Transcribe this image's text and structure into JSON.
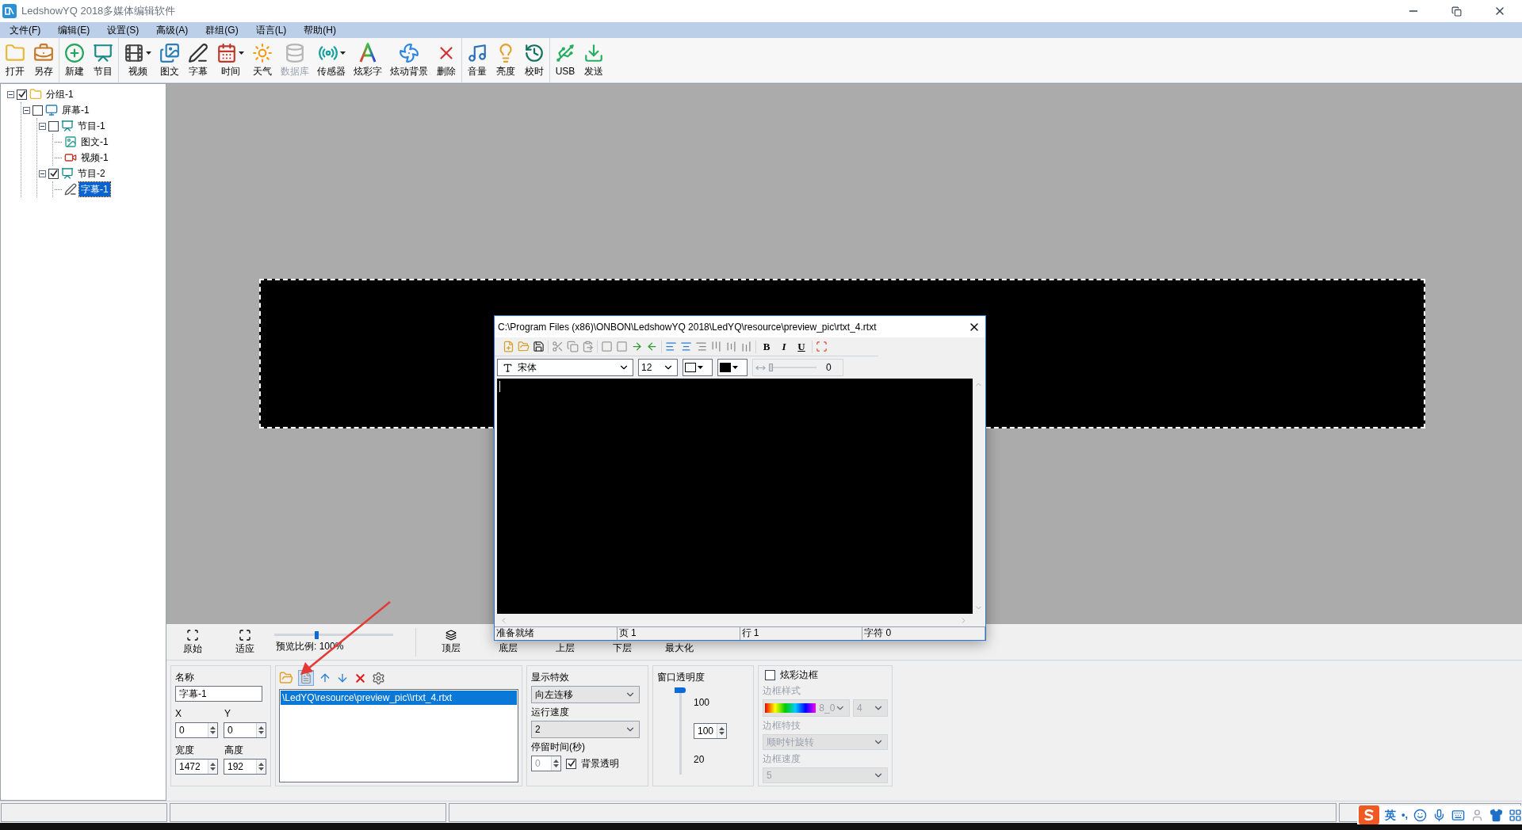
{
  "window": {
    "title": "LedshowYQ 2018多媒体编辑软件"
  },
  "menu": [
    "文件(F)",
    "编辑(E)",
    "设置(S)",
    "高级(A)",
    "群组(G)",
    "语言(L)",
    "帮助(H)"
  ],
  "toolbar_groups": [
    [
      {
        "label": "打开",
        "disabled": false,
        "dropdown": false
      },
      {
        "label": "另存",
        "disabled": false,
        "dropdown": false
      }
    ],
    [
      {
        "label": "新建",
        "disabled": false,
        "dropdown": false
      },
      {
        "label": "节目",
        "disabled": false,
        "dropdown": false
      }
    ],
    [
      {
        "label": "视频",
        "disabled": false,
        "dropdown": true
      },
      {
        "label": "图文",
        "disabled": false,
        "dropdown": false
      },
      {
        "label": "字幕",
        "disabled": false,
        "dropdown": false
      },
      {
        "label": "时间",
        "disabled": false,
        "dropdown": true
      },
      {
        "label": "天气",
        "disabled": false,
        "dropdown": false
      },
      {
        "label": "数据库",
        "disabled": true,
        "dropdown": false
      },
      {
        "label": "传感器",
        "disabled": false,
        "dropdown": true
      },
      {
        "label": "炫彩字",
        "disabled": false,
        "dropdown": false
      },
      {
        "label": "炫动背景",
        "disabled": false,
        "dropdown": false
      },
      {
        "label": "删除",
        "disabled": false,
        "dropdown": false
      }
    ],
    [
      {
        "label": "音量",
        "disabled": false,
        "dropdown": false
      },
      {
        "label": "亮度",
        "disabled": false,
        "dropdown": false
      },
      {
        "label": "校时",
        "disabled": false,
        "dropdown": false
      }
    ],
    [
      {
        "label": "USB",
        "disabled": false,
        "dropdown": false
      },
      {
        "label": "发送",
        "disabled": false,
        "dropdown": false
      }
    ]
  ],
  "tree": [
    {
      "label": "分组-1",
      "kind": "group",
      "checked": true,
      "expanded": true,
      "selected": false,
      "children": [
        {
          "label": "屏幕-1",
          "kind": "screen",
          "checked": false,
          "expanded": true,
          "selected": false,
          "children": [
            {
              "label": "节目-1",
              "kind": "program",
              "checked": false,
              "expanded": true,
              "selected": false,
              "children": [
                {
                  "label": "图文-1",
                  "kind": "image-text",
                  "selected": false
                },
                {
                  "label": "视频-1",
                  "kind": "video",
                  "selected": false
                }
              ]
            },
            {
              "label": "节目-2",
              "kind": "program",
              "checked": true,
              "expanded": true,
              "selected": false,
              "children": [
                {
                  "label": "字幕-1",
                  "kind": "subtitle",
                  "selected": true
                }
              ]
            }
          ]
        }
      ]
    }
  ],
  "editor": {
    "title": "C:\\Program Files (x86)\\ONBON\\LedshowYQ 2018\\LedYQ\\resource\\preview_pic\\rtxt_4.rtxt",
    "format_buttons": [
      "B",
      "I",
      "U"
    ],
    "font": "宋体",
    "size": "12",
    "spacing": {
      "value": "0",
      "level": 0.0
    },
    "status": [
      "准备就绪",
      "页 1",
      "行 1",
      "字符 0"
    ]
  },
  "view_toolbar": {
    "fit_buttons": [
      "原始",
      "适应"
    ],
    "zoom": {
      "label": "预览比例: 100%",
      "level": 0.35
    },
    "layer_buttons": [
      "顶层",
      "底层",
      "上层",
      "下层",
      "最大化"
    ]
  },
  "properties": {
    "name_label": "名称",
    "name_value": "字幕-1",
    "x_label": "X",
    "x_value": "0",
    "y_label": "Y",
    "y_value": "0",
    "width_label": "宽度",
    "width_value": "1472",
    "height_label": "高度",
    "height_value": "192"
  },
  "files": [
    {
      "label": "\\LedYQ\\resource\\preview_pic\\\\rtxt_4.rtxt",
      "selected": true
    }
  ],
  "effects": {
    "effect_label": "显示特效",
    "effect_value": "向左连移",
    "speed_label": "运行速度",
    "speed_value": "2",
    "stay_label": "停留时间(秒)",
    "stay_value": "0",
    "stay_disabled": true,
    "transparent_label": "背景透明",
    "transparent_checked": true
  },
  "opacity": {
    "label": "窗口透明度",
    "max": "100",
    "min": "20",
    "value": "100",
    "level": 1.0
  },
  "border": {
    "label": "炫彩边框",
    "checked": false,
    "style_label": "边框样式",
    "style_value": "8_0",
    "width_value": "4",
    "effect_label": "边框特技",
    "effect_value": "顺时针旋转",
    "speed_label": "边框速度",
    "speed_value": "5"
  },
  "ime": {
    "mode": "英",
    "punctuation": "•,"
  }
}
